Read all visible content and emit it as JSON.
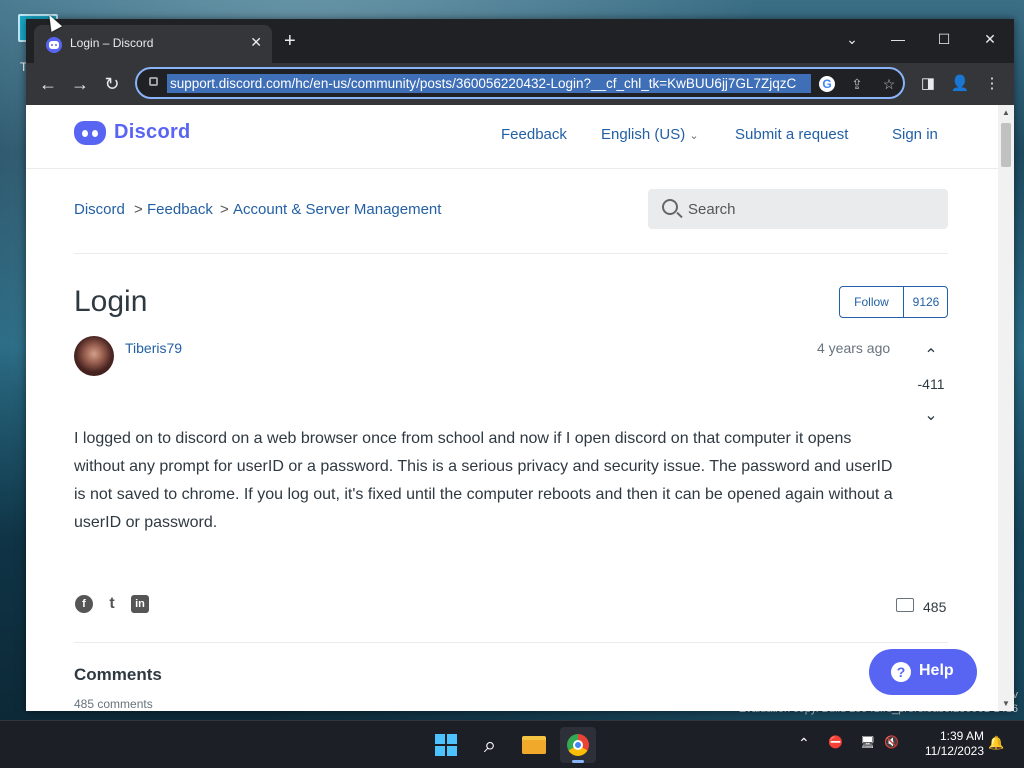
{
  "desktop": {
    "icon_label": "T",
    "watermark_line1": "v",
    "watermark_line2": "Evaluation copy. Build 25941.rs_prerelease.230901-1416"
  },
  "browser": {
    "tab_title": "Login – Discord",
    "tab_close": "✕",
    "new_tab": "+",
    "window_controls": {
      "menu": "⌄",
      "minimize": "—",
      "maximize": "☐",
      "close": "✕"
    },
    "nav": {
      "back": "←",
      "forward": "→",
      "reload": "↻"
    },
    "url": "support.discord.com/hc/en-us/community/posts/360056220432-Login?__cf_chl_tk=KwBUU6jj7GL7ZjqzC",
    "omnibox_icons": {
      "google": "G",
      "share": "⇪",
      "bookmark": "☆"
    },
    "toolbar_icons": {
      "sidepanel": "◨",
      "profile": "👤",
      "menu": "⋮"
    }
  },
  "site": {
    "logo_text": "Discord",
    "nav": {
      "feedback": "Feedback",
      "language": "English (US)",
      "language_caret": "⌄",
      "submit": "Submit a request",
      "signin": "Sign in"
    },
    "breadcrumb": [
      "Discord",
      "Feedback",
      "Account & Server Management"
    ],
    "breadcrumb_sep": ">",
    "search_placeholder": "Search",
    "post": {
      "title": "Login",
      "follow_label": "Follow",
      "follow_count": "9126",
      "author": "Tiberis79",
      "date": "4 years ago",
      "vote_up": "⌃",
      "vote_score": "-411",
      "vote_down": "⌄",
      "body": "I logged on to discord on a web browser once from school and now if I open discord on that computer it opens without any prompt for userID or a password.  This is a serious privacy and security issue.  The password and userID is not saved to chrome.  If you log out, it's fixed until the computer reboots and then it can be opened again without a userID or password.",
      "share": {
        "facebook": "f",
        "twitter": "t",
        "linkedin": "in"
      },
      "comment_count": "485"
    },
    "comments": {
      "heading": "Comments",
      "sub": "485 comments"
    },
    "help": {
      "icon": "?",
      "label": "Help"
    }
  },
  "taskbar": {
    "search_icon": "⌕",
    "tray": {
      "chevron": "⌃",
      "net1": "⛔",
      "net2": "🖥",
      "volume": "🔇",
      "bell": "🔔"
    },
    "time": "1:39 AM",
    "date": "11/12/2023"
  },
  "colors": {
    "accent": "#5865f2",
    "link": "#2360a5",
    "chrome_dark": "#202124"
  }
}
